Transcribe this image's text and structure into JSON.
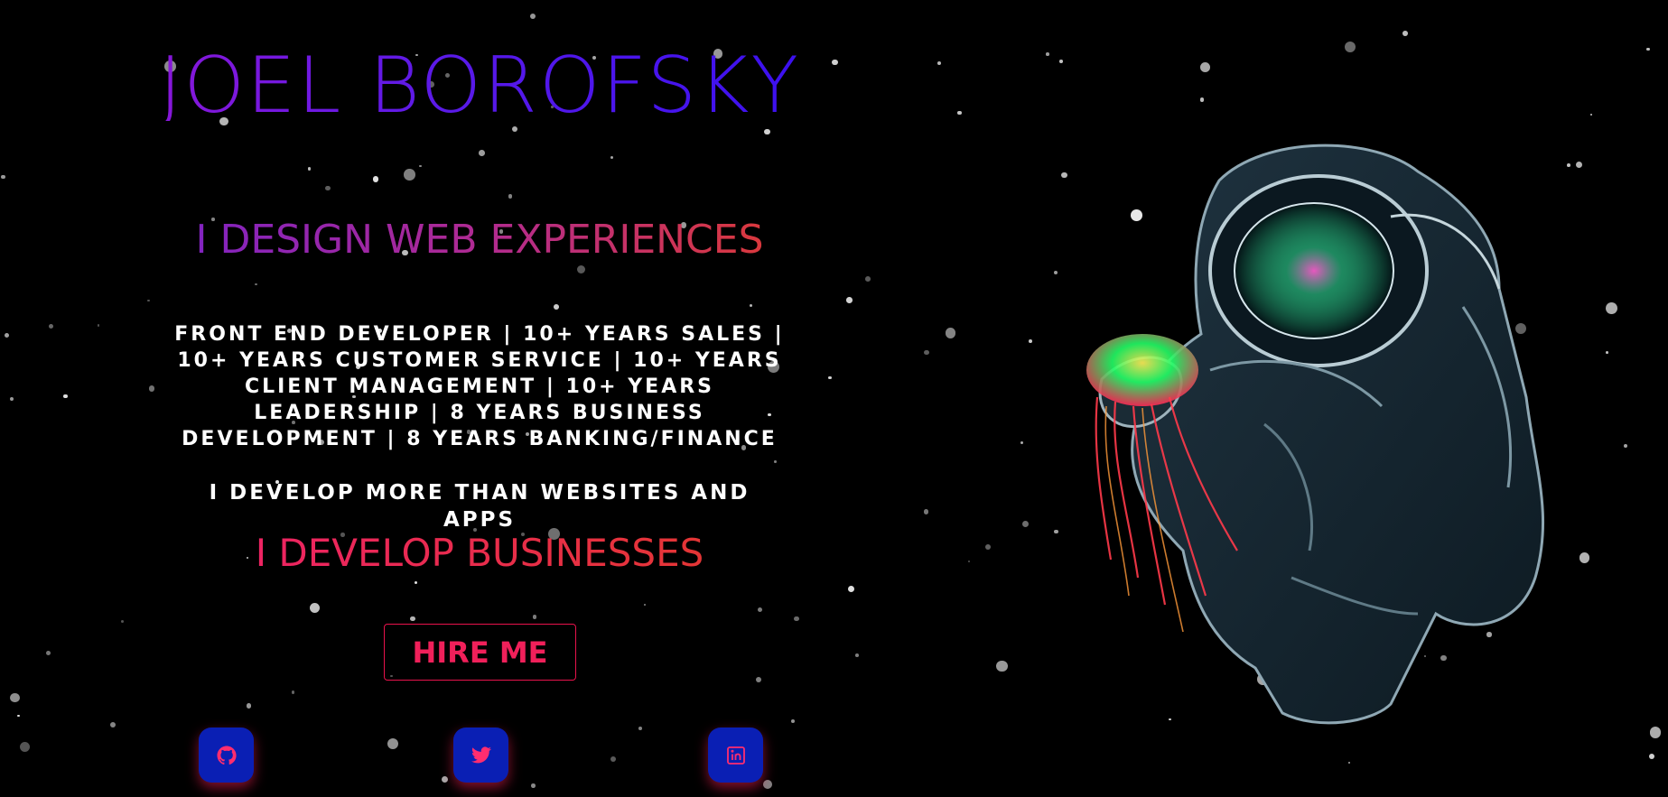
{
  "hero": {
    "name": "JOEL BOROFSKY",
    "headline": "I DESIGN WEB EXPERIENCES",
    "experience": "FRONT END DEVELOPER | 10+ YEARS SALES | 10+ YEARS CUSTOMER SERVICE | 10+ YEARS CLIENT MANAGEMENT | 10+ YEARS LEADERSHIP | 8 YEARS BUSINESS DEVELOPMENT | 8 YEARS BANKING/FINANCE",
    "develop_more": "I DEVELOP MORE THAN WEBSITES AND APPS",
    "develop_businesses": "I DEVELOP BUSINESSES",
    "hire_label": "HIRE ME"
  },
  "social": [
    {
      "icon": "github-icon"
    },
    {
      "icon": "twitter-icon"
    },
    {
      "icon": "linkedin-icon"
    }
  ],
  "colors": {
    "background": "#000000",
    "name_gradient_start": "#8a17d8",
    "name_gradient_end": "#3a10f0",
    "headline_gradient_start": "#7a22c8",
    "headline_gradient_end": "#e13b2e",
    "accent_pink": "#f0205a",
    "social_bg": "#0a1fb4"
  },
  "illustration": {
    "icon": "astronaut-with-jellyfish-illustration"
  }
}
